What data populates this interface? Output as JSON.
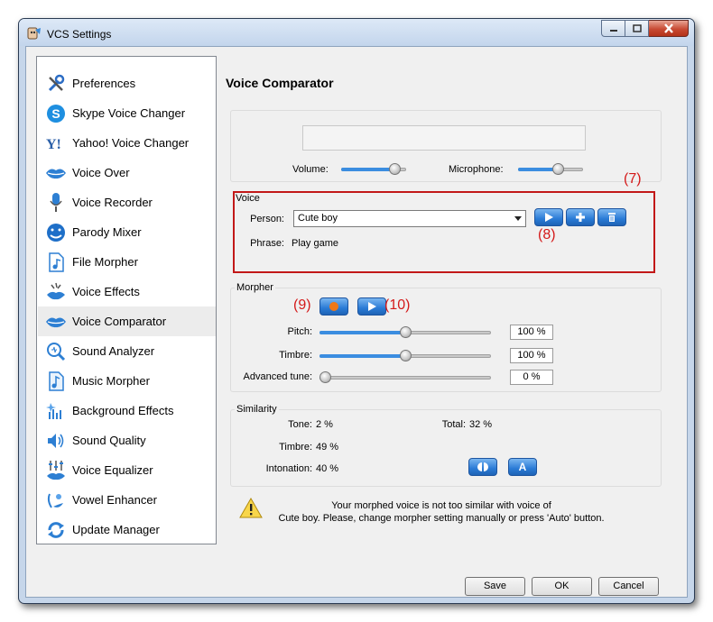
{
  "window": {
    "title": "VCS Settings"
  },
  "sidebar": {
    "items": [
      {
        "label": "Preferences",
        "icon": "wrench-icon"
      },
      {
        "label": "Skype Voice Changer",
        "icon": "skype-icon"
      },
      {
        "label": "Yahoo! Voice Changer",
        "icon": "yahoo-icon"
      },
      {
        "label": "Voice Over",
        "icon": "lips-icon"
      },
      {
        "label": "Voice Recorder",
        "icon": "microphone-icon"
      },
      {
        "label": "Parody Mixer",
        "icon": "parody-face-icon"
      },
      {
        "label": "File Morpher",
        "icon": "file-music-icon"
      },
      {
        "label": "Voice Effects",
        "icon": "effects-icon"
      },
      {
        "label": "Voice Comparator",
        "icon": "comparator-lips-icon",
        "selected": true
      },
      {
        "label": "Sound Analyzer",
        "icon": "magnifier-icon"
      },
      {
        "label": "Music Morpher",
        "icon": "music-note-icon"
      },
      {
        "label": "Background Effects",
        "icon": "background-effects-icon"
      },
      {
        "label": "Sound Quality",
        "icon": "speaker-icon"
      },
      {
        "label": "Voice Equalizer",
        "icon": "equalizer-icon"
      },
      {
        "label": "Vowel Enhancer",
        "icon": "vowel-icon"
      },
      {
        "label": "Update Manager",
        "icon": "update-arrows-icon"
      }
    ]
  },
  "panel": {
    "title": "Voice Comparator"
  },
  "levels": {
    "volume_label": "Volume:",
    "volume_level": 0.9,
    "microphone_label": "Microphone:",
    "microphone_level": 0.65
  },
  "voice": {
    "group_label": "Voice",
    "person_label": "Person:",
    "person_value": "Cute boy",
    "phrase_label": "Phrase:",
    "phrase_value": "Play game"
  },
  "morpher": {
    "group_label": "Morpher",
    "pitch_label": "Pitch:",
    "pitch_value": "100 %",
    "pitch_level": 0.5,
    "timbre_label": "Timbre:",
    "timbre_value": "100 %",
    "timbre_level": 0.5,
    "advanced_label": "Advanced tune:",
    "advanced_value": "0 %",
    "advanced_level": 0.0
  },
  "similarity": {
    "group_label": "Similarity",
    "tone_label": "Tone:",
    "tone_value": "2 %",
    "total_label": "Total:",
    "total_value": "32 %",
    "timbre_label": "Timbre:",
    "timbre_value": "49 %",
    "intonation_label": "Intonation:",
    "intonation_value": "40 %",
    "auto_button_label": "A"
  },
  "warning": {
    "line1": "Your morphed voice is not too similar with voice of",
    "line2": "Cute boy. Please, change morpher setting manually or press 'Auto' button."
  },
  "annotations": {
    "a7": "(7)",
    "a8": "(8)",
    "a9": "(9)",
    "a10": "(10)"
  },
  "buttons": {
    "save": "Save",
    "ok": "OK",
    "cancel": "Cancel"
  },
  "colors": {
    "accent": "#2a7bd6",
    "annotation": "#d41a1a",
    "record": "#f07818"
  }
}
